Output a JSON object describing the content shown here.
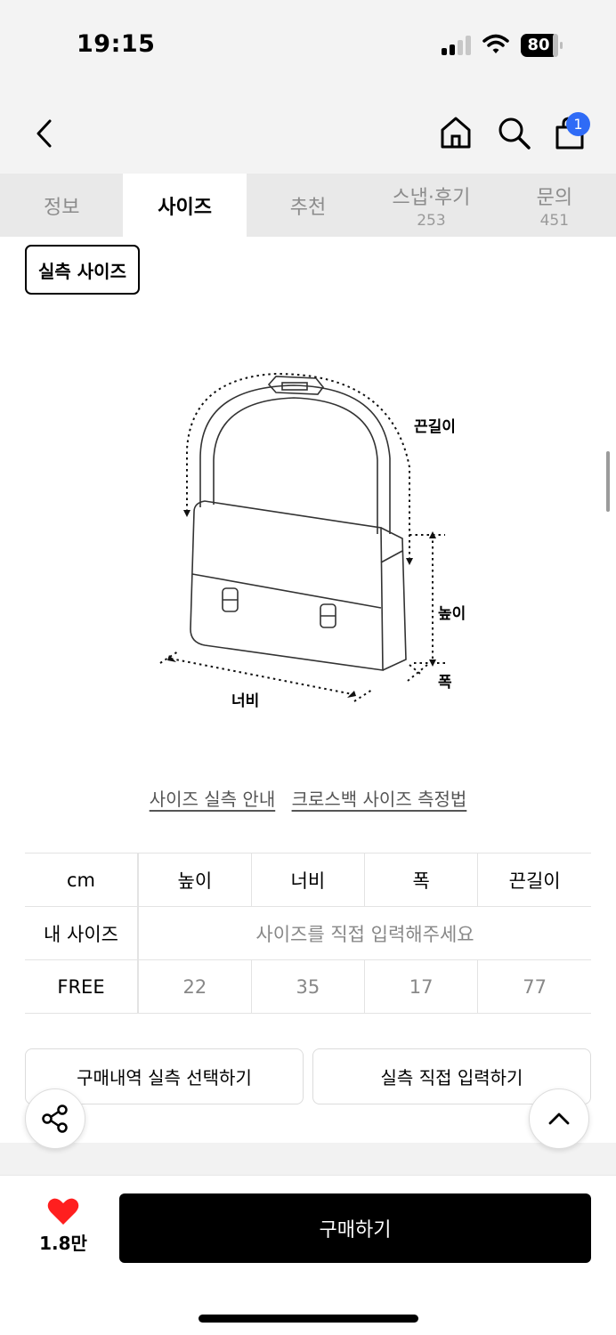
{
  "status": {
    "time": "19:15",
    "battery": "80"
  },
  "header": {
    "back_icon": "chevron-left-icon",
    "home_icon": "home-icon",
    "search_icon": "search-icon",
    "cart_icon": "shopping-bag-icon",
    "cart_badge": "1"
  },
  "tabs": [
    {
      "label": "정보",
      "count": ""
    },
    {
      "label": "사이즈",
      "count": ""
    },
    {
      "label": "추천",
      "count": ""
    },
    {
      "label": "스냅·후기",
      "count": "253"
    },
    {
      "label": "문의",
      "count": "451"
    }
  ],
  "real_size_button": "실측 사이즈",
  "diagram": {
    "strap": "끈길이",
    "height": "높이",
    "depth": "폭",
    "width": "너비"
  },
  "guides": {
    "size_guide": "사이즈 실측 안내",
    "crossbag_guide": "크로스백 사이즈 측정법"
  },
  "size_table": {
    "unit": "cm",
    "headers": [
      "높이",
      "너비",
      "폭",
      "끈길이"
    ],
    "my_size_label": "내 사이즈",
    "my_size_placeholder": "사이즈를 직접 입력해주세요",
    "rows": [
      {
        "size": "FREE",
        "values": [
          "22",
          "35",
          "17",
          "77"
        ]
      }
    ]
  },
  "actions": {
    "select_purchase": "구매내역 실측 선택하기",
    "direct_input": "실측 직접 입력하기"
  },
  "floating": {
    "share_icon": "share-icon",
    "scroll_top_icon": "chevron-up-icon"
  },
  "bottom": {
    "like_icon": "heart-icon",
    "like_count": "1.8만",
    "buy_label": "구매하기"
  },
  "colors": {
    "accent_badge": "#2f6bf6",
    "heart": "#ff1f1f",
    "buy_button": "#000000"
  }
}
